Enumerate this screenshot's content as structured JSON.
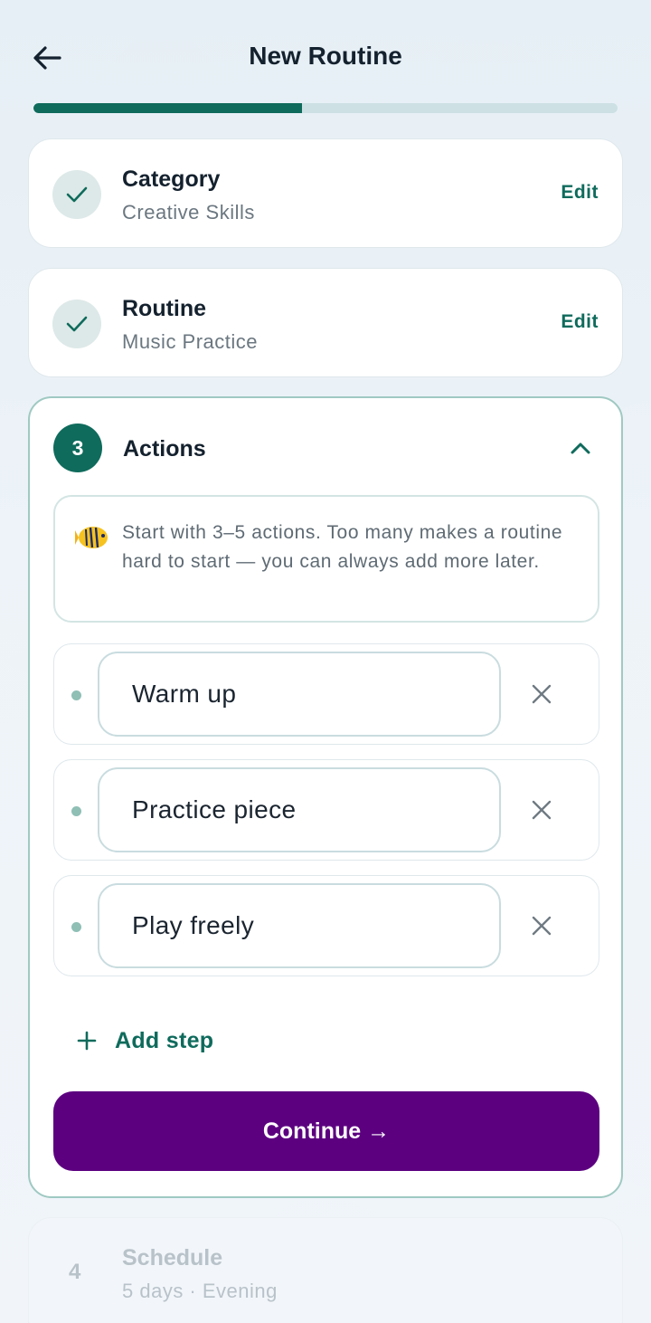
{
  "header": {
    "title": "New Routine",
    "back_icon": "arrow-left-icon",
    "progress": 0.46
  },
  "completed_steps": [
    {
      "title": "Category",
      "value": "Creative Skills",
      "edit_label": "Edit",
      "icon": "check-icon"
    },
    {
      "title": "Routine",
      "value": "Music Practice",
      "edit_label": "Edit",
      "icon": "check-icon"
    }
  ],
  "active_step": {
    "number": "3",
    "title": "Actions",
    "collapse_icon": "chevron-up-icon",
    "tip": {
      "icon": "tropical-fish-icon",
      "text": "Start with 3–5 actions. Too many makes a routine hard to start — you can always add more later."
    },
    "actions": [
      {
        "value": "Warm up",
        "remove_icon": "close-icon"
      },
      {
        "value": "Practice piece",
        "remove_icon": "close-icon"
      },
      {
        "value": "Play freely",
        "remove_icon": "close-icon"
      }
    ],
    "add_step_label": "Add step",
    "continue_label": "Continue →"
  },
  "pending_step": {
    "number": "4",
    "title": "Schedule",
    "value": "5 days · Evening"
  },
  "colors": {
    "accent": "#0f6b5c",
    "primary_button": "#5c0080",
    "progress_track": "#cde0e4"
  }
}
